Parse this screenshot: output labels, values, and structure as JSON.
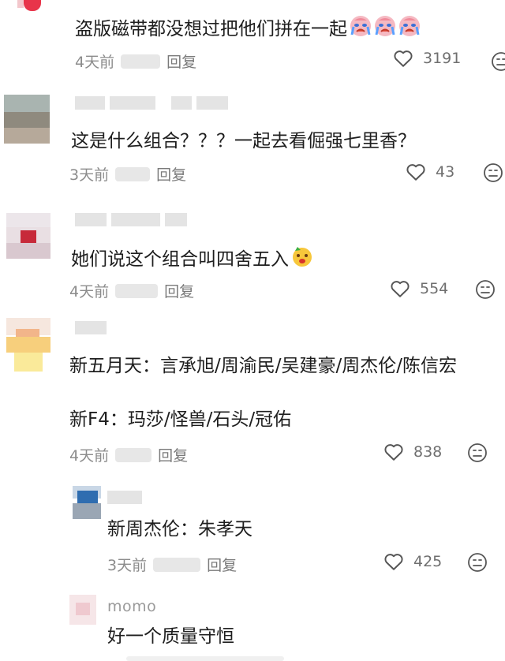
{
  "comments": [
    {
      "text": "盗版磁带都没想过把他们拼在一起",
      "emoji": "crying-face-emoji",
      "time": "4天前",
      "reply_label": "回复",
      "likes": "3191"
    },
    {
      "text": "这是什么组合？？？一起去看倔强七里香？",
      "time": "3天前",
      "reply_label": "回复",
      "likes": "43"
    },
    {
      "text": "她们说这个组合叫四舍五入",
      "emoji": "dizzy-face-emoji",
      "time": "4天前",
      "reply_label": "回复",
      "likes": "554"
    },
    {
      "text_line1": "新五月天：言承旭/周渝民/吴建豪/周杰伦/陈信宏",
      "text_line2": "新F4：玛莎/怪兽/石头/冠佑",
      "time": "4天前",
      "reply_label": "回复",
      "likes": "838"
    },
    {
      "text": "新周杰伦：朱孝天",
      "time": "3天前",
      "reply_label": "回复",
      "likes": "425"
    },
    {
      "username": "momo",
      "text": "好一个质量守恒"
    }
  ],
  "colors": {
    "like_icon": "#555555",
    "text": "#1e1e1e",
    "meta": "#8c8c8c"
  }
}
